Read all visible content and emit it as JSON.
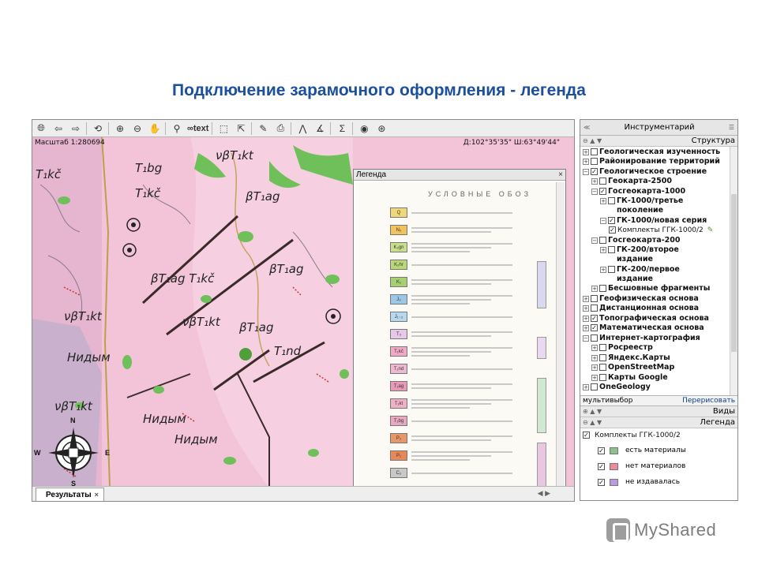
{
  "slide": {
    "title": "Подключение зарамочного оформления - легенда"
  },
  "map": {
    "toolbar": {
      "text_tool": "text"
    },
    "scale": "Масштаб 1:280694",
    "coords": "Д:102°35'35\"   Ш:63°49'44\"",
    "labels": [
      "T₁bg",
      "νβT₁kt",
      "T₁kč",
      "βT₁ag",
      "βT₁ag T₁kč",
      "βT₁ag",
      "νβT₁kt",
      "βT₁ag",
      "T₁nd",
      "νβT₁kt",
      "Нидым",
      "νβT₁kt",
      "Нидым",
      "T₁kč",
      "Нидым"
    ],
    "compass": {
      "n": "N",
      "s": "S",
      "w": "W",
      "e": "E"
    }
  },
  "legend_popup": {
    "title": "Легенда",
    "close": "×",
    "header": "УСЛОВНЫЕ ОБОЗ",
    "rows": [
      {
        "code": "Q",
        "color": "#f0d878"
      },
      {
        "code": "N₂",
        "color": "#f2c25c"
      },
      {
        "code": "K₂gn",
        "color": "#c8e08a"
      },
      {
        "code": "K₂hr",
        "color": "#b8d878"
      },
      {
        "code": "K₁",
        "color": "#a8d070"
      },
      {
        "code": "J₃",
        "color": "#9cc8e8"
      },
      {
        "code": "J₁₋₂",
        "color": "#b8d8f0"
      },
      {
        "code": "T₃",
        "color": "#e8c8e8"
      },
      {
        "code": "T₁kč",
        "color": "#f4a8c8"
      },
      {
        "code": "T₁nd",
        "color": "#f0b8d0"
      },
      {
        "code": "T₁ag",
        "color": "#e898b8"
      },
      {
        "code": "T₁kt",
        "color": "#f0b0c8"
      },
      {
        "code": "T₁bg",
        "color": "#e8a8c0"
      },
      {
        "code": "P₂",
        "color": "#e89868"
      },
      {
        "code": "P₁",
        "color": "#e88858"
      },
      {
        "code": "C₂",
        "color": "#c8c8c8"
      }
    ]
  },
  "results": {
    "tab_label": "Результаты",
    "close": "×"
  },
  "panel": {
    "title": "Инструментарий",
    "structure_title": "Структура",
    "tree": [
      {
        "label": "Геологическая изученность",
        "level": 0,
        "expander": "+",
        "checked": false
      },
      {
        "label": "Районирование территорий",
        "level": 0,
        "expander": "+",
        "checked": false
      },
      {
        "label": "Геологическое строение",
        "level": 0,
        "expander": "−",
        "checked": true
      },
      {
        "label": "Геокарта-2500",
        "level": 1,
        "expander": "+",
        "checked": false
      },
      {
        "label": "Госгеокарта-1000",
        "level": 1,
        "expander": "−",
        "checked": true
      },
      {
        "label": "ГК-1000/третье\nпоколение",
        "level": 2,
        "expander": "+",
        "checked": false
      },
      {
        "label": "ГК-1000/новая серия",
        "level": 2,
        "expander": "−",
        "checked": true
      },
      {
        "label": "Комплекты ГГК-1000/2",
        "level": 3,
        "expander": "",
        "checked": true,
        "normal": true,
        "edit": true
      },
      {
        "label": "Госгеокарта-200",
        "level": 1,
        "expander": "−",
        "checked": false
      },
      {
        "label": "ГК-200/второе\nиздание",
        "level": 2,
        "expander": "+",
        "checked": false
      },
      {
        "label": "ГК-200/первое\nиздание",
        "level": 2,
        "expander": "+",
        "checked": false
      },
      {
        "label": "Бесшовные фрагменты",
        "level": 1,
        "expander": "+",
        "checked": false
      },
      {
        "label": "Геофизическая основа",
        "level": 0,
        "expander": "+",
        "checked": false
      },
      {
        "label": "Дистанционная основа",
        "level": 0,
        "expander": "+",
        "checked": false
      },
      {
        "label": "Топографическая основа",
        "level": 0,
        "expander": "+",
        "checked": true
      },
      {
        "label": "Математическая основа",
        "level": 0,
        "expander": "+",
        "checked": true
      },
      {
        "label": "Интернет-картография",
        "level": 0,
        "expander": "−",
        "checked": false
      },
      {
        "label": "Росреестр",
        "level": 1,
        "expander": "+",
        "checked": false
      },
      {
        "label": "Яндекс.Карты",
        "level": 1,
        "expander": "+",
        "checked": false
      },
      {
        "label": "OpenStreetMap",
        "level": 1,
        "expander": "+",
        "checked": false
      },
      {
        "label": "Карты Google",
        "level": 1,
        "expander": "+",
        "checked": false
      },
      {
        "label": "OneGeology",
        "level": 0,
        "expander": "+",
        "checked": false
      }
    ],
    "multiselect": "мультивыбор",
    "redraw": "Перерисовать",
    "views_title": "Виды",
    "legend_title": "Легенда",
    "legend_group": "Комплекты ГГК-1000/2",
    "legend_items": [
      {
        "label": "есть материалы",
        "color": "#8cc08c"
      },
      {
        "label": "нет материалов",
        "color": "#f08a9a"
      },
      {
        "label": "не издавалась",
        "color": "#b89ae0"
      }
    ]
  },
  "watermark": {
    "text": "MyShared"
  }
}
